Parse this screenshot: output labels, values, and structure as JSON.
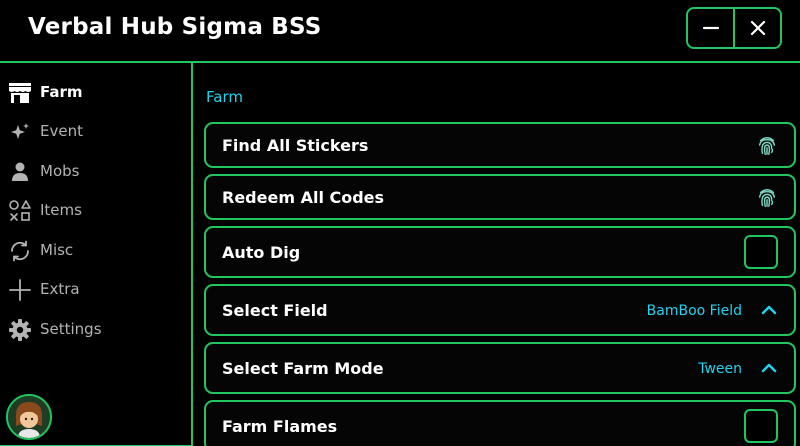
{
  "window": {
    "title": "Verbal Hub Sigma BSS",
    "accent_color": "#22c55e",
    "value_color": "#22d3ee",
    "controls": {
      "minimize_icon": "minus-icon",
      "close_icon": "close-icon"
    }
  },
  "sidebar": {
    "items": [
      {
        "label": "Farm",
        "icon": "store-icon",
        "active": true
      },
      {
        "label": "Event",
        "icon": "sparkles-icon",
        "active": false
      },
      {
        "label": "Mobs",
        "icon": "user-icon",
        "active": false
      },
      {
        "label": "Items",
        "icon": "shapes-icon",
        "active": false
      },
      {
        "label": "Misc",
        "icon": "refresh-icon",
        "active": false
      },
      {
        "label": "Extra",
        "icon": "plus-icon",
        "active": false
      },
      {
        "label": "Settings",
        "icon": "gear-icon",
        "active": false
      }
    ],
    "avatar_icon": "avatar-icon"
  },
  "main": {
    "section_title": "Farm",
    "rows": [
      {
        "label": "Find All Stickers",
        "type": "button",
        "icon": "fingerprint-icon"
      },
      {
        "label": "Redeem All Codes",
        "type": "button",
        "icon": "fingerprint-icon"
      },
      {
        "label": "Auto Dig",
        "type": "toggle",
        "checked": false
      },
      {
        "label": "Select Field",
        "type": "dropdown",
        "value": "BamBoo Field",
        "icon": "chevron-up-icon"
      },
      {
        "label": "Select Farm Mode",
        "type": "dropdown",
        "value": "Tween",
        "icon": "chevron-up-icon"
      },
      {
        "label": "Farm Flames",
        "type": "toggle",
        "checked": false
      }
    ]
  }
}
